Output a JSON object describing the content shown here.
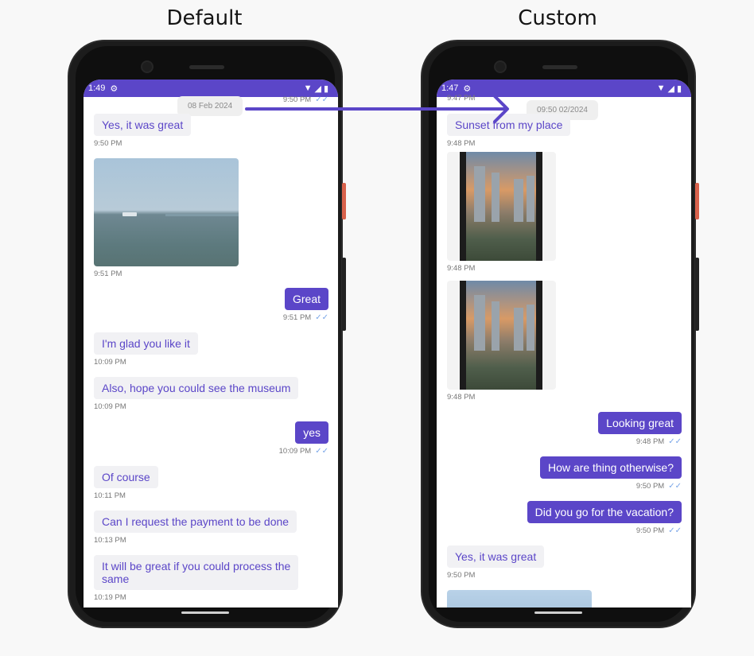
{
  "headings": {
    "left": "Default",
    "right": "Custom"
  },
  "left_phone": {
    "status": {
      "time": "1:49"
    },
    "date_separator": "08 Feb 2024",
    "messages": [
      {
        "top_time": "9:50 PM"
      },
      {
        "text": "Yes, it was great",
        "time": "9:50 PM"
      },
      {
        "image": "sea-photo",
        "time": "9:51 PM"
      },
      {
        "text": "Great",
        "time": "9:51 PM"
      },
      {
        "text": "I'm glad you like it",
        "time": "10:09 PM"
      },
      {
        "text": "Also, hope you could see the museum",
        "time": "10:09 PM"
      },
      {
        "text": "yes",
        "time": "10:09 PM"
      },
      {
        "text": "Of course",
        "time": "10:11 PM"
      },
      {
        "text": "Can I request the payment to be done",
        "time": "10:13 PM"
      },
      {
        "text_line1": "It will be great if you could process the",
        "text_line2": "same",
        "time": "10:19 PM"
      }
    ]
  },
  "right_phone": {
    "status": {
      "time": "1:47"
    },
    "top_partial_time": "9:47 PM",
    "date_separator": "09:50 02/2024",
    "messages": [
      {
        "text": "Sunset from my place",
        "time": "9:48 PM"
      },
      {
        "image": "city-photo",
        "time": "9:48 PM"
      },
      {
        "image": "city-photo",
        "time": "9:48 PM"
      },
      {
        "text": "Looking great",
        "time": "9:48 PM"
      },
      {
        "text": "How are thing otherwise?",
        "time": "9:50 PM"
      },
      {
        "text": "Did you go for the vacation?",
        "time": "9:50 PM"
      },
      {
        "text": "Yes, it was great",
        "time": "9:50 PM"
      }
    ]
  },
  "icons": {
    "settings": "gear-icon",
    "wifi": "wifi-icon",
    "signal": "signal-icon",
    "battery": "battery-icon",
    "read": "double-check-icon",
    "arrow": "arrow-right-icon"
  },
  "colors": {
    "accent": "#5b46c8",
    "incoming_bubble": "#f1f1f4",
    "read_tick": "#7aa6e8",
    "side_button": "#d9624c"
  }
}
